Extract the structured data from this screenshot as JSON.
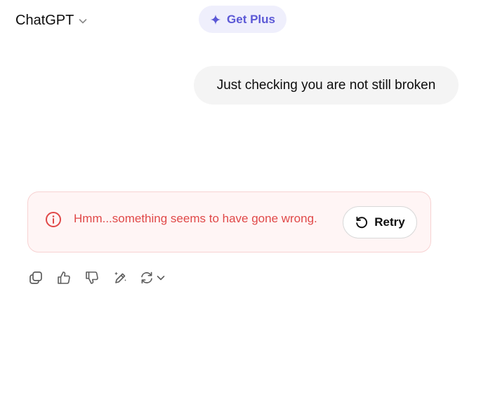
{
  "header": {
    "model_name": "ChatGPT",
    "model_chevron_icon": "chevron-down-icon",
    "upgrade_label": "Get Plus",
    "upgrade_icon": "sparkle-icon",
    "upgrade_color": "#5b58d6",
    "upgrade_bg": "#efeffc"
  },
  "conversation": {
    "user_message": "Just checking you are not still broken",
    "error": {
      "message": "Hmm...something seems to have gone wrong.",
      "icon": "error-circle-icon",
      "color": "#e04848",
      "retry_label": "Retry",
      "retry_icon": "retry-icon"
    },
    "actions": [
      {
        "name": "copy",
        "icon": "copy-icon"
      },
      {
        "name": "thumbs-up",
        "icon": "thumbs-up-icon"
      },
      {
        "name": "thumbs-down",
        "icon": "thumbs-down-icon"
      },
      {
        "name": "edit",
        "icon": "edit-sparkle-icon"
      },
      {
        "name": "regenerate",
        "icon": "regenerate-icon"
      }
    ]
  }
}
